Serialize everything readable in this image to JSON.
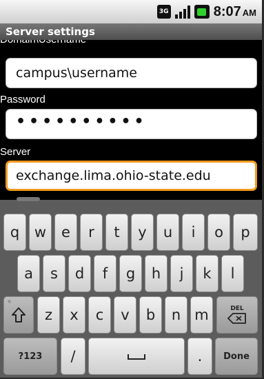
{
  "status_bar": {
    "network": "3G",
    "time": "8:07",
    "ampm": "AM",
    "icons": [
      "3g-icon",
      "signal-icon",
      "battery-icon"
    ]
  },
  "header": {
    "title": "Server settings"
  },
  "form": {
    "domain_username_label": "Domain\\Username",
    "domain_username_value": "campus\\username",
    "password_label": "Password",
    "password_value": "••••••••••",
    "server_label": "Server",
    "server_value": "exchange.lima.ohio-state.edu"
  },
  "keyboard": {
    "row1": [
      "q",
      "w",
      "e",
      "r",
      "t",
      "y",
      "u",
      "i",
      "o",
      "p"
    ],
    "row2": [
      "a",
      "s",
      "d",
      "f",
      "g",
      "h",
      "j",
      "k",
      "l"
    ],
    "row3": [
      "z",
      "x",
      "c",
      "v",
      "b",
      "n",
      "m"
    ],
    "del_label": "DEL",
    "mode_label": "?123",
    "slash": "/",
    "period": ".",
    "done_label": "Done"
  },
  "colors": {
    "focus_border": "#f39a1d",
    "battery": "#2fd12f"
  }
}
